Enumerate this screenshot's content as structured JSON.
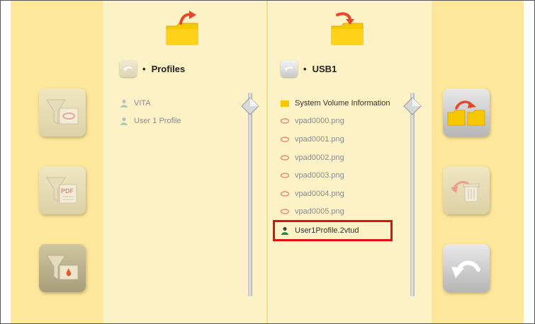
{
  "left_sidebar": {
    "buttons": [
      {
        "icon": "filter-image-icon",
        "state": "disabled"
      },
      {
        "icon": "filter-pdf-icon",
        "state": "disabled",
        "badge_text": "PDF"
      },
      {
        "icon": "filter-profile-icon",
        "state": "enabled"
      }
    ]
  },
  "left_pane": {
    "folder_icon": "folder-export-icon",
    "title": "Profiles",
    "items": [
      {
        "label": "VITA",
        "icon": "profile-icon"
      },
      {
        "label": "User 1 Profile",
        "icon": "profile-icon"
      }
    ]
  },
  "right_pane": {
    "folder_icon": "folder-import-icon",
    "title": "USB1",
    "items": [
      {
        "label": "System Volume Information",
        "icon": "folder-icon"
      },
      {
        "label": "vpad0000.png",
        "icon": "image-file-icon"
      },
      {
        "label": "vpad0001.png",
        "icon": "image-file-icon"
      },
      {
        "label": "vpad0002.png",
        "icon": "image-file-icon"
      },
      {
        "label": "vpad0003.png",
        "icon": "image-file-icon"
      },
      {
        "label": "vpad0004.png",
        "icon": "image-file-icon"
      },
      {
        "label": "vpad0005.png",
        "icon": "image-file-icon"
      },
      {
        "label": "User1Profile.2vtud",
        "icon": "profile-icon",
        "highlighted": true
      }
    ]
  },
  "right_sidebar": {
    "buttons": [
      {
        "icon": "copy-folder-icon",
        "state": "enabled"
      },
      {
        "icon": "delete-icon",
        "state": "disabled"
      },
      {
        "icon": "back-icon",
        "state": "enabled"
      }
    ]
  },
  "colors": {
    "highlight_border": "#e01010",
    "folder_yellow": "#f7c800",
    "arrow_red": "#e8452a",
    "profile_green": "#1f8f4a"
  }
}
